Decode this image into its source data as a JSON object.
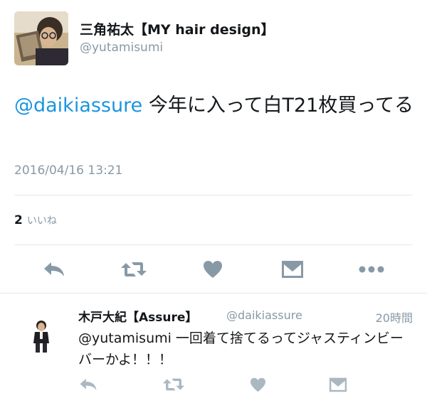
{
  "tweet": {
    "author": {
      "name": "三角祐太【MY hair design】",
      "handle": "@yutamisumi"
    },
    "text": {
      "mention": "@daikiassure",
      "body": " 今年に入って白T21枚買ってる"
    },
    "timestamp": "2016/04/16 13:21",
    "likes": {
      "count": "2",
      "label": "いいね"
    },
    "actions": [
      "reply-icon",
      "retweet-icon",
      "heart-icon",
      "message-icon",
      "more-icon"
    ]
  },
  "reply": {
    "author": {
      "name": "木戸大紀【Assure】",
      "handle": "@daikiassure"
    },
    "time": "20時間",
    "text": "@yutamisumi 一回着て捨てるってジャスティンビーバーかよ！！！",
    "actions": [
      "reply-icon",
      "retweet-icon",
      "heart-icon",
      "message-icon"
    ]
  },
  "colors": {
    "link": "#1b95e0",
    "muted": "#8899a6",
    "icon": "#8899a6",
    "icon_light": "#aab8c2",
    "divider": "#e1e8ed"
  }
}
